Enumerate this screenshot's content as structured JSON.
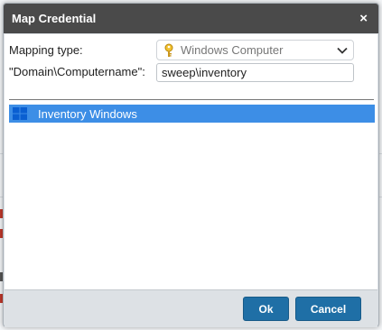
{
  "dialog": {
    "title": "Map Credential",
    "close_glyph": "×"
  },
  "form": {
    "mapping_type_label": "Mapping type:",
    "mapping_type_value": "Windows Computer",
    "mapping_type_icon": "key-icon",
    "name_label": "\"Domain\\Computername\":",
    "name_value": "sweep\\inventory"
  },
  "list": {
    "items": [
      {
        "label": "Inventory Windows",
        "icon": "windows-icon",
        "selected": true
      }
    ]
  },
  "footer": {
    "ok_label": "Ok",
    "cancel_label": "Cancel"
  },
  "colors": {
    "titlebar": "#4a4a4a",
    "selection": "#3d8ee6",
    "button": "#1f6fa6"
  }
}
